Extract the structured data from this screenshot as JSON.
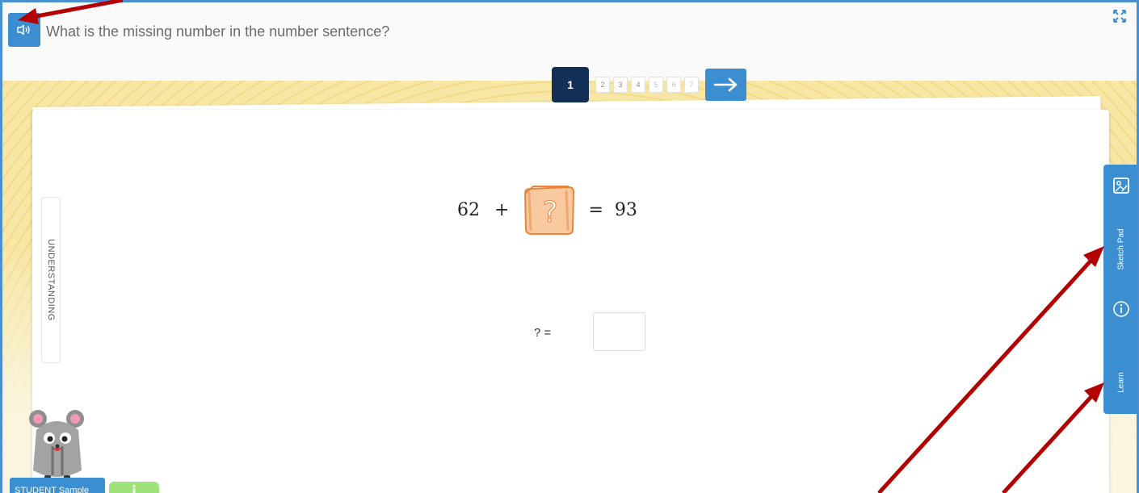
{
  "question": {
    "text": "What is the missing number in the number sentence?",
    "speaker_icon": "speaker-icon"
  },
  "pager": {
    "pages": [
      "1",
      "2",
      "3",
      "4",
      "5",
      "6",
      "7"
    ],
    "current": "1",
    "next_icon": "arrow-right-icon"
  },
  "understanding": {
    "label": "UNDERSTANDING"
  },
  "equation": {
    "left": "62",
    "plus": "+",
    "unknown_icon": "question-mark-box-icon",
    "equals": "=",
    "right": "93"
  },
  "answer": {
    "label": "? =",
    "value": ""
  },
  "sidebar": {
    "sketch_pad_label": "Sketch Pad",
    "learn_label": "Learn",
    "sketch_icon": "sketch-pad-icon",
    "info_icon": "info-icon"
  },
  "footer": {
    "student_label": "STUDENT Sample"
  },
  "colors": {
    "frame_blue": "#4a8fd0",
    "button_blue": "#3b8fd1",
    "active_page": "#132f55",
    "arrow_red": "#b30000",
    "box_orange": "#f5a15e",
    "background_yellow": "#f6e29a"
  }
}
